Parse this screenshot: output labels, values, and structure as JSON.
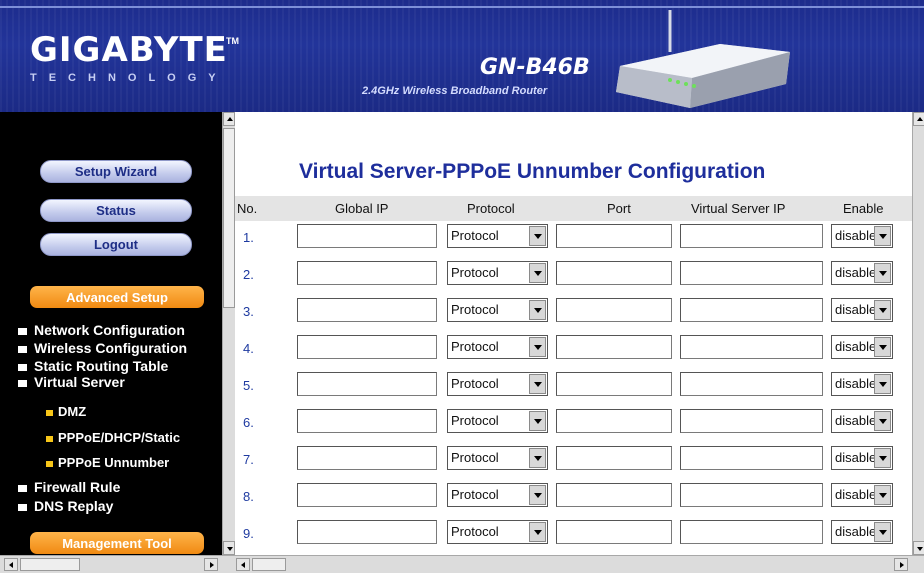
{
  "header": {
    "logo": "GIGABYTE",
    "logo_tm": "TM",
    "logo_sub": "TECHNOLOGY",
    "model": "GN-B46B",
    "model_sub": "2.4GHz Wireless Broadband Router"
  },
  "nav": {
    "buttons": [
      "Setup Wizard",
      "Status",
      "Logout"
    ],
    "advanced_setup": "Advanced Setup",
    "links": [
      "Network Configuration",
      "Wireless Configuration",
      "Static Routing Table",
      "Virtual Server"
    ],
    "sublinks": [
      "DMZ",
      "PPPoE/DHCP/Static",
      "PPPoE Unnumber"
    ],
    "links2": [
      "Firewall Rule",
      "DNS Replay"
    ],
    "management_tool": "Management Tool"
  },
  "main": {
    "title": "Virtual Server-PPPoE Unnumber Configuration",
    "columns": [
      "No.",
      "Global IP",
      "Protocol",
      "Port",
      "Virtual Server IP",
      "Enable"
    ],
    "rows": [
      {
        "no": "1.",
        "protocol": "Protocol",
        "enable": "disable"
      },
      {
        "no": "2.",
        "protocol": "Protocol",
        "enable": "disable"
      },
      {
        "no": "3.",
        "protocol": "Protocol",
        "enable": "disable"
      },
      {
        "no": "4.",
        "protocol": "Protocol",
        "enable": "disable"
      },
      {
        "no": "5.",
        "protocol": "Protocol",
        "enable": "disable"
      },
      {
        "no": "6.",
        "protocol": "Protocol",
        "enable": "disable"
      },
      {
        "no": "7.",
        "protocol": "Protocol",
        "enable": "disable"
      },
      {
        "no": "8.",
        "protocol": "Protocol",
        "enable": "disable"
      },
      {
        "no": "9.",
        "protocol": "Protocol",
        "enable": "disable"
      }
    ]
  },
  "colors": {
    "header_blue": "#22349a",
    "title_blue": "#1e2e9c",
    "nav_orange": "#f08a12",
    "nav_bg": "#000000"
  }
}
